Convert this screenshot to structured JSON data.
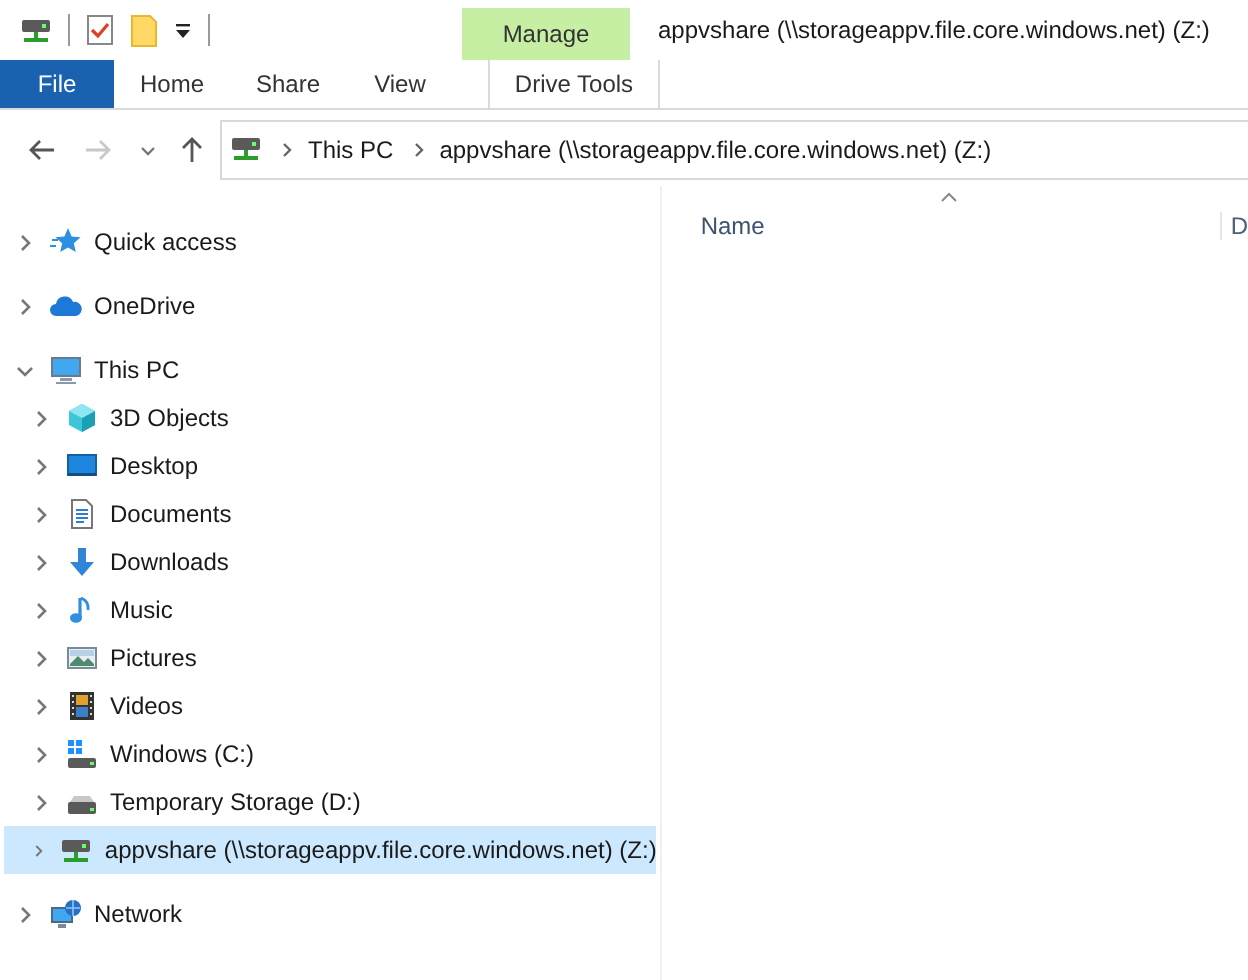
{
  "window": {
    "title": "appvshare (\\\\storageappv.file.core.windows.net) (Z:)"
  },
  "ribbon": {
    "context_group": "Manage",
    "tabs": [
      {
        "label": "File",
        "kind": "file",
        "selected": false
      },
      {
        "label": "Home",
        "kind": "tab",
        "selected": false
      },
      {
        "label": "Share",
        "kind": "tab",
        "selected": false
      },
      {
        "label": "View",
        "kind": "tab",
        "selected": false
      },
      {
        "label": "Drive Tools",
        "kind": "context",
        "selected": false
      }
    ]
  },
  "address": {
    "back_disabled": false,
    "forward_disabled": true,
    "crumbs": [
      "This PC",
      "appvshare (\\\\storageappv.file.core.windows.net) (Z:)"
    ]
  },
  "columns": [
    {
      "label": "Name",
      "sorted": true
    },
    {
      "label": "D",
      "sorted": false
    }
  ],
  "sidebar": {
    "items": [
      {
        "label": "Quick access",
        "kind": "star",
        "expanded": false,
        "selected": false
      },
      {
        "label": "OneDrive",
        "kind": "cloud",
        "expanded": false,
        "selected": false
      },
      {
        "label": "This PC",
        "kind": "pc",
        "expanded": true,
        "selected": false,
        "children": [
          {
            "label": "3D Objects",
            "kind": "cube",
            "expanded": false,
            "selected": false
          },
          {
            "label": "Desktop",
            "kind": "desktop",
            "expanded": false,
            "selected": false
          },
          {
            "label": "Documents",
            "kind": "document",
            "expanded": false,
            "selected": false
          },
          {
            "label": "Downloads",
            "kind": "download",
            "expanded": false,
            "selected": false
          },
          {
            "label": "Music",
            "kind": "music",
            "expanded": false,
            "selected": false
          },
          {
            "label": "Pictures",
            "kind": "picture",
            "expanded": false,
            "selected": false
          },
          {
            "label": "Videos",
            "kind": "video",
            "expanded": false,
            "selected": false
          },
          {
            "label": "Windows (C:)",
            "kind": "windows-drive",
            "expanded": false,
            "selected": false
          },
          {
            "label": "Temporary Storage (D:)",
            "kind": "drive",
            "expanded": false,
            "selected": false
          },
          {
            "label": "appvshare (\\\\storageappv.file.core.windows.net) (Z:)",
            "kind": "network-drive",
            "expanded": false,
            "selected": true
          }
        ]
      },
      {
        "label": "Network",
        "kind": "network",
        "expanded": false,
        "selected": false
      }
    ]
  }
}
